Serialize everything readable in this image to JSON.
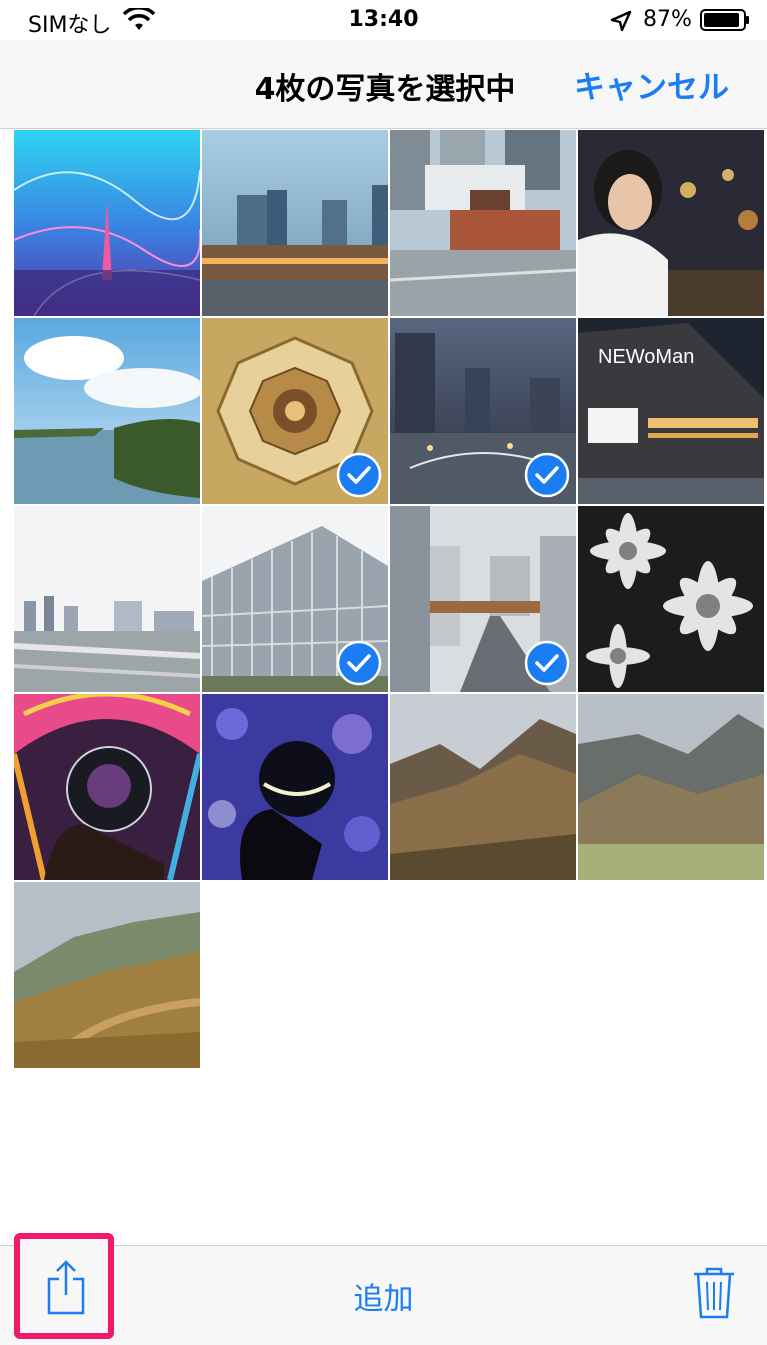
{
  "status_bar": {
    "carrier": "SIMなし",
    "time": "13:40",
    "battery_percent": "87%",
    "icons": [
      "wifi-icon",
      "location-arrow-icon",
      "battery-icon"
    ]
  },
  "nav": {
    "title": "4枚の写真を選択中",
    "cancel_label": "キャンセル"
  },
  "photos": [
    {
      "subject": "tokyo-tower-light-trails",
      "selected": false
    },
    {
      "subject": "tokyo-station-dusk",
      "selected": false
    },
    {
      "subject": "tokyo-station-aerial",
      "selected": false
    },
    {
      "subject": "woman-portrait-night",
      "selected": false
    },
    {
      "subject": "lake-clouds",
      "selected": false
    },
    {
      "subject": "station-dome-ceiling",
      "selected": true
    },
    {
      "subject": "city-night-skyline",
      "selected": true
    },
    {
      "subject": "newoman-building",
      "selected": false
    },
    {
      "subject": "waterfront-skyline",
      "selected": false
    },
    {
      "subject": "glass-office-building",
      "selected": false
    },
    {
      "subject": "street-railway-bridge",
      "selected": true
    },
    {
      "subject": "daisies-monochrome",
      "selected": false
    },
    {
      "subject": "crystal-ball-illumination",
      "selected": false
    },
    {
      "subject": "crystal-ball-bokeh",
      "selected": false
    },
    {
      "subject": "mountain-ridge-autumn",
      "selected": false
    },
    {
      "subject": "mountain-valley",
      "selected": false
    },
    {
      "subject": "mountain-grass-slope",
      "selected": false
    }
  ],
  "toolbar": {
    "add_label": "追加",
    "icons": [
      "share-icon",
      "trash-icon"
    ]
  },
  "colors": {
    "accent": "#1a7ef2",
    "highlight_border": "#f0196a",
    "check_badge": "#1a7ef2"
  }
}
